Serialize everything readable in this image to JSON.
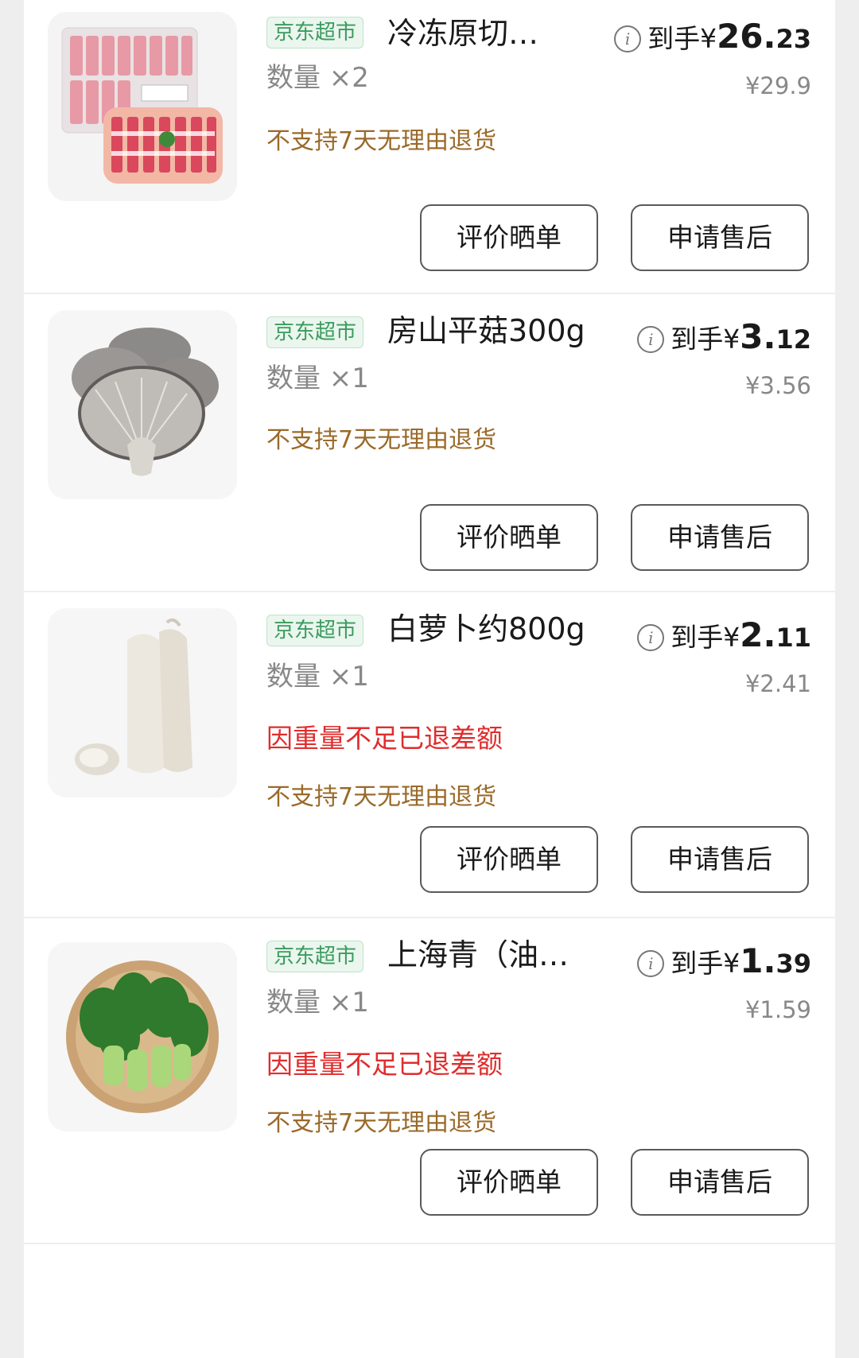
{
  "items": [
    {
      "store_tag": "京东超市",
      "name": "冷冻原切…",
      "quantity": "数量 ×2",
      "price_prefix": "到手¥",
      "price_int": "26.",
      "price_dec": "23",
      "original_price": "¥29.9",
      "refund_note": "",
      "return_policy": "不支持7天无理由退货",
      "review_button": "评价晒单",
      "aftersale_button": "申请售后",
      "icon": "frozen-meat-image"
    },
    {
      "store_tag": "京东超市",
      "name": "房山平菇300g",
      "quantity": "数量 ×1",
      "price_prefix": "到手¥",
      "price_int": "3.",
      "price_dec": "12",
      "original_price": "¥3.56",
      "refund_note": "",
      "return_policy": "不支持7天无理由退货",
      "review_button": "评价晒单",
      "aftersale_button": "申请售后",
      "icon": "oyster-mushroom-image"
    },
    {
      "store_tag": "京东超市",
      "name": "白萝卜约800g",
      "quantity": "数量 ×1",
      "price_prefix": "到手¥",
      "price_int": "2.",
      "price_dec": "11",
      "original_price": "¥2.41",
      "refund_note": "因重量不足已退差额",
      "return_policy": "不支持7天无理由退货",
      "review_button": "评价晒单",
      "aftersale_button": "申请售后",
      "icon": "white-radish-image"
    },
    {
      "store_tag": "京东超市",
      "name": "上海青（油…",
      "quantity": "数量 ×1",
      "price_prefix": "到手¥",
      "price_int": "1.",
      "price_dec": "39",
      "original_price": "¥1.59",
      "refund_note": "因重量不足已退差额",
      "return_policy": "不支持7天无理由退货",
      "review_button": "评价晒单",
      "aftersale_button": "申请售后",
      "icon": "bok-choy-image"
    }
  ],
  "colors": {
    "store_tag": "#3b9b5e",
    "refund_note": "#e02d2d",
    "return_policy": "#9a6a2a",
    "muted": "#888888"
  }
}
